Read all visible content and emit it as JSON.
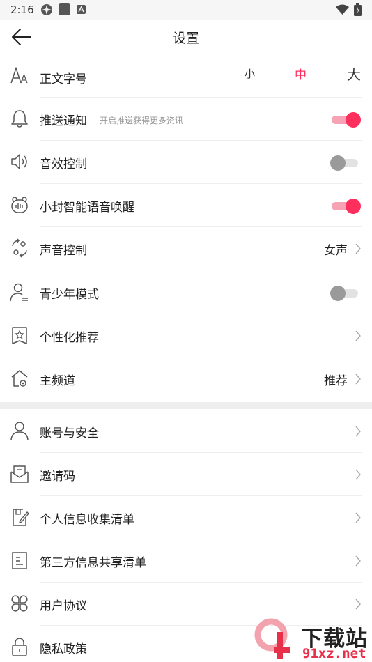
{
  "status": {
    "time": "2:16"
  },
  "header": {
    "title": "设置"
  },
  "font_size": {
    "label": "正文字号",
    "options": [
      "小",
      "中",
      "大"
    ],
    "selected": 1
  },
  "settings": [
    {
      "label": "推送通知",
      "sub": "开启推送获得更多资讯",
      "toggle": true
    },
    {
      "label": "音效控制",
      "toggle": false
    },
    {
      "label": "小封智能语音唤醒",
      "toggle": true
    },
    {
      "label": "声音控制",
      "value": "女声"
    },
    {
      "label": "青少年模式",
      "toggle": false
    },
    {
      "label": "个性化推荐"
    },
    {
      "label": "主频道",
      "value": "推荐"
    }
  ],
  "account": [
    {
      "label": "账号与安全"
    },
    {
      "label": "邀请码"
    },
    {
      "label": "个人信息收集清单"
    },
    {
      "label": "第三方信息共享清单"
    },
    {
      "label": "用户协议"
    },
    {
      "label": "隐私政策"
    }
  ],
  "watermark": {
    "title": "下载站",
    "domain": "91xz.net"
  },
  "colors": {
    "accent": "#fe2f5d",
    "accent_track": "#f7a3b6",
    "off_knob": "#9a9a9a",
    "off_track": "#e2e2e2",
    "separator": "#eeeeee"
  }
}
